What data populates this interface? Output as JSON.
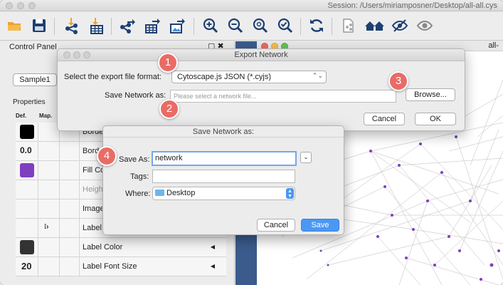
{
  "window": {
    "session": "Session: /Users/miriamposner/Desktop/all-all.cys"
  },
  "toolbar": {
    "icons": [
      "open-folder-icon",
      "save-icon",
      "import-network-icon",
      "import-table-icon",
      "export-network-icon",
      "export-table-icon",
      "export-image-icon",
      "zoom-in-icon",
      "zoom-out-icon",
      "zoom-fit-icon",
      "zoom-selected-icon",
      "refresh-icon",
      "new-network-icon",
      "home-icon",
      "hide-icon",
      "show-icon"
    ],
    "colors": {
      "orange": "#f0a030",
      "navy": "#1d3f73",
      "blue": "#3d8fd8"
    }
  },
  "control_panel": {
    "title": "Control Panel",
    "window_icons": "▢ ✖",
    "tab": "Sample1",
    "properties_tab": "Properties",
    "def_label": "Def.",
    "map_label": "Map.",
    "rows": [
      {
        "value_text": "",
        "label": "Borde",
        "swatch": "#000000"
      },
      {
        "value_text": "0.0",
        "label": "Bord",
        "swatch": ""
      },
      {
        "value_text": "",
        "label": "Fill Co",
        "swatch": "#7f3fbf"
      },
      {
        "value_text": "",
        "label": "Heigh",
        "swatch": ""
      },
      {
        "value_text": "",
        "label": "Image",
        "swatch": ""
      },
      {
        "value_text": "",
        "label": "Label",
        "swatch": ""
      },
      {
        "value_text": "",
        "label": "Label Color",
        "swatch": "#333333"
      },
      {
        "value_text": "20",
        "label": "Label Font Size",
        "swatch": ""
      }
    ]
  },
  "network_view": {
    "title": "all-"
  },
  "export_dialog": {
    "title": "Export Network",
    "format_label": "Select the export file format:",
    "format_value": "Cytoscape.js JSON (*.cyjs)",
    "save_as_label": "Save Network as:",
    "file_placeholder": "Please select a network file...",
    "browse_label": "Browse...",
    "cancel_label": "Cancel",
    "ok_label": "OK"
  },
  "save_dialog": {
    "title": "Save Network as:",
    "save_as_label": "Save As:",
    "save_as_value": "network",
    "tags_label": "Tags:",
    "tags_value": "",
    "where_label": "Where:",
    "where_value": "Desktop",
    "cancel_label": "Cancel",
    "save_label": "Save"
  },
  "callouts": [
    "1",
    "2",
    "3",
    "4"
  ]
}
